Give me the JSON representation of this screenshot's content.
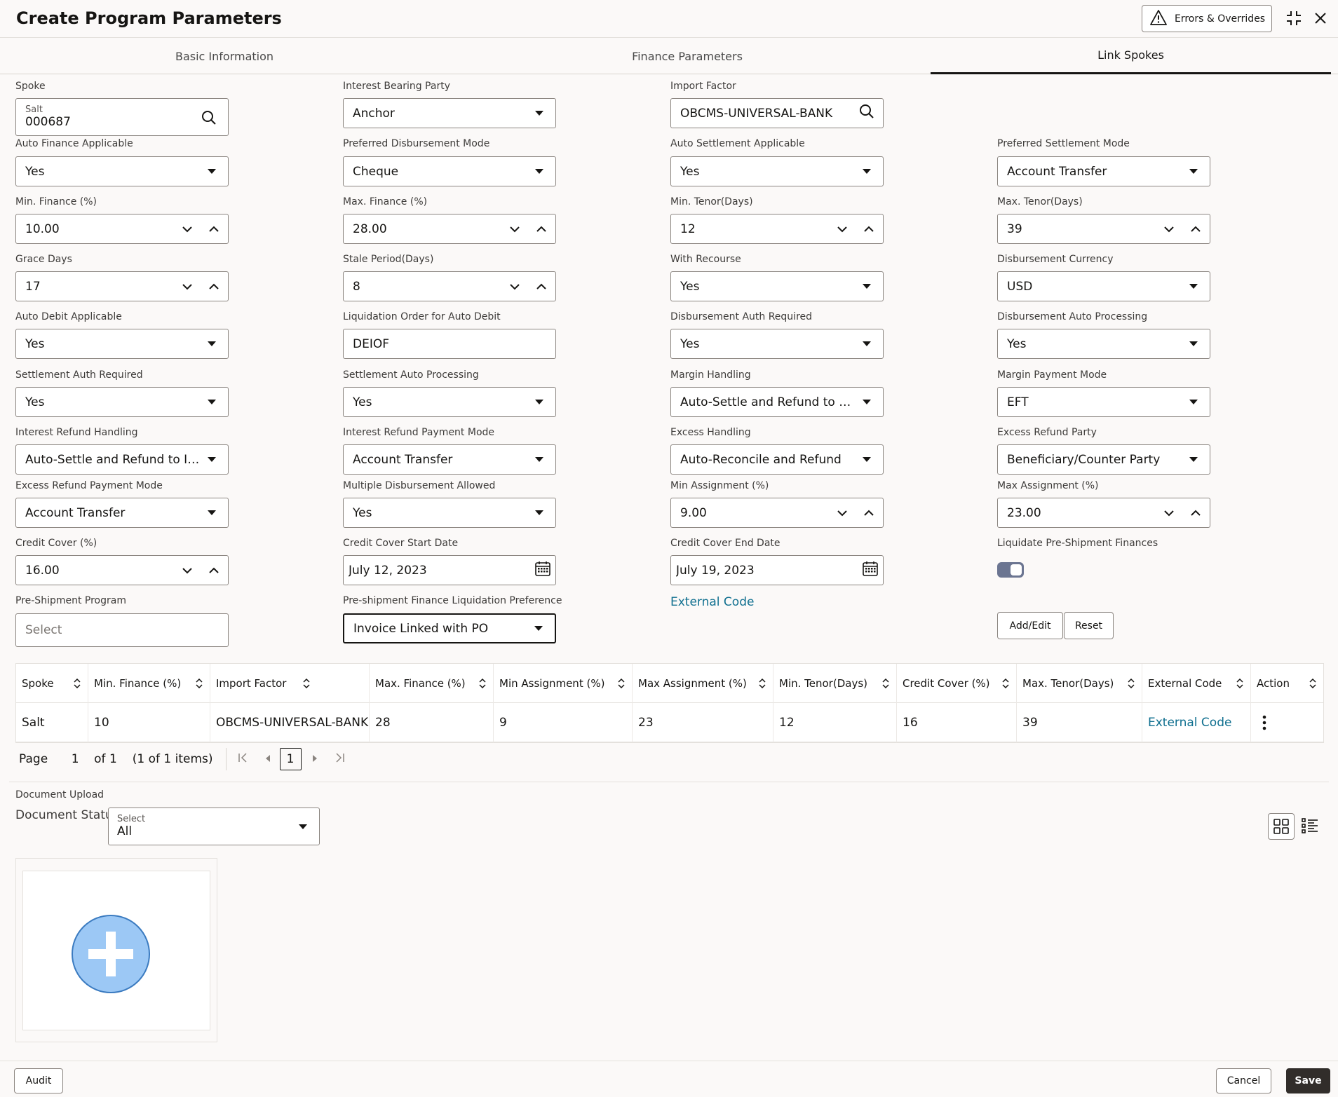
{
  "header": {
    "title": "Create Program Parameters",
    "errors_label": "Errors & Overrides"
  },
  "tabs": [
    {
      "label": "Basic Information"
    },
    {
      "label": "Finance Parameters"
    },
    {
      "label": "Link Spokes"
    }
  ],
  "form": {
    "spoke": {
      "label": "Spoke",
      "sub": "Salt",
      "value": "000687"
    },
    "interest_bearing_party": {
      "label": "Interest Bearing Party",
      "value": "Anchor"
    },
    "import_factor": {
      "label": "Import Factor",
      "value": "OBCMS-UNIVERSAL-BANK"
    },
    "auto_finance_applicable": {
      "label": "Auto Finance Applicable",
      "value": "Yes"
    },
    "preferred_disbursement_mode": {
      "label": "Preferred Disbursement Mode",
      "value": "Cheque"
    },
    "auto_settlement_applicable": {
      "label": "Auto Settlement Applicable",
      "value": "Yes"
    },
    "preferred_settlement_mode": {
      "label": "Preferred Settlement Mode",
      "value": "Account Transfer"
    },
    "min_finance": {
      "label": "Min. Finance (%)",
      "value": "10.00"
    },
    "max_finance": {
      "label": "Max. Finance (%)",
      "value": "28.00"
    },
    "min_tenor": {
      "label": "Min. Tenor(Days)",
      "value": "12"
    },
    "max_tenor": {
      "label": "Max. Tenor(Days)",
      "value": "39"
    },
    "grace_days": {
      "label": "Grace Days",
      "value": "17"
    },
    "stale_period": {
      "label": "Stale Period(Days)",
      "value": "8"
    },
    "with_recourse": {
      "label": "With Recourse",
      "value": "Yes"
    },
    "disbursement_currency": {
      "label": "Disbursement Currency",
      "value": "USD"
    },
    "auto_debit_applicable": {
      "label": "Auto Debit Applicable",
      "value": "Yes"
    },
    "liquidation_order": {
      "label": "Liquidation Order for Auto Debit",
      "value": "DEIOF"
    },
    "disbursement_auth_required": {
      "label": "Disbursement Auth Required",
      "value": "Yes"
    },
    "disbursement_auto_processing": {
      "label": "Disbursement Auto Processing",
      "value": "Yes"
    },
    "settlement_auth_required": {
      "label": "Settlement Auth Required",
      "value": "Yes"
    },
    "settlement_auto_processing": {
      "label": "Settlement Auto Processing",
      "value": "Yes"
    },
    "margin_handling": {
      "label": "Margin Handling",
      "value": "Auto-Settle and Refund to S..."
    },
    "margin_payment_mode": {
      "label": "Margin Payment Mode",
      "value": "EFT"
    },
    "interest_refund_handling": {
      "label": "Interest Refund Handling",
      "value": "Auto-Settle and Refund to IBP"
    },
    "interest_refund_payment_mode": {
      "label": "Interest Refund Payment Mode",
      "value": "Account Transfer"
    },
    "excess_handling": {
      "label": "Excess Handling",
      "value": "Auto-Reconcile and Refund"
    },
    "excess_refund_party": {
      "label": "Excess Refund Party",
      "value": "Beneficiary/Counter Party"
    },
    "excess_refund_payment_mode": {
      "label": "Excess Refund Payment Mode",
      "value": "Account Transfer"
    },
    "multiple_disbursement_allowed": {
      "label": "Multiple Disbursement Allowed",
      "value": "Yes"
    },
    "min_assignment": {
      "label": "Min Assignment (%)",
      "value": "9.00"
    },
    "max_assignment": {
      "label": "Max Assignment (%)",
      "value": "23.00"
    },
    "credit_cover": {
      "label": "Credit Cover (%)",
      "value": "16.00"
    },
    "credit_cover_start": {
      "label": "Credit Cover Start Date",
      "value": "July 12, 2023"
    },
    "credit_cover_end": {
      "label": "Credit Cover End Date",
      "value": "July 19, 2023"
    },
    "liquidate_pre_shipment": {
      "label": "Liquidate Pre-Shipment Finances",
      "checked": true
    },
    "pre_shipment_program": {
      "label": "Pre-Shipment Program",
      "placeholder": "Select"
    },
    "pre_shipment_pref": {
      "label": "Pre-shipment Finance Liquidation Preference",
      "value": "Invoice Linked with PO"
    },
    "external_code_link": "External Code",
    "add_edit": "Add/Edit",
    "reset": "Reset"
  },
  "table": {
    "columns": [
      "Spoke",
      "Min. Finance (%)",
      "Import Factor",
      "Max. Finance (%)",
      "Min Assignment (%)",
      "Max Assignment (%)",
      "Min. Tenor(Days)",
      "Credit Cover (%)",
      "Max. Tenor(Days)",
      "External Code",
      "Action"
    ],
    "rows": [
      [
        "Salt",
        "10",
        "OBCMS-UNIVERSAL-BANK",
        "28",
        "9",
        "23",
        "12",
        "16",
        "39",
        "External Code",
        ""
      ]
    ]
  },
  "pager": {
    "page_label": "Page",
    "page_value": "1",
    "of_label": "of 1",
    "items_label": "(1 of 1 items)",
    "current": "1"
  },
  "documents": {
    "section_label": "Document Upload",
    "status_label": "Document Status",
    "select_label": "Select",
    "select_value": "All"
  },
  "footer": {
    "audit": "Audit",
    "cancel": "Cancel",
    "save": "Save"
  },
  "colors": {
    "accent": "#0f6f8f",
    "toggle": "#6b7591",
    "upload_circle": "#9cc8f5",
    "save_bg": "#312d2a"
  }
}
